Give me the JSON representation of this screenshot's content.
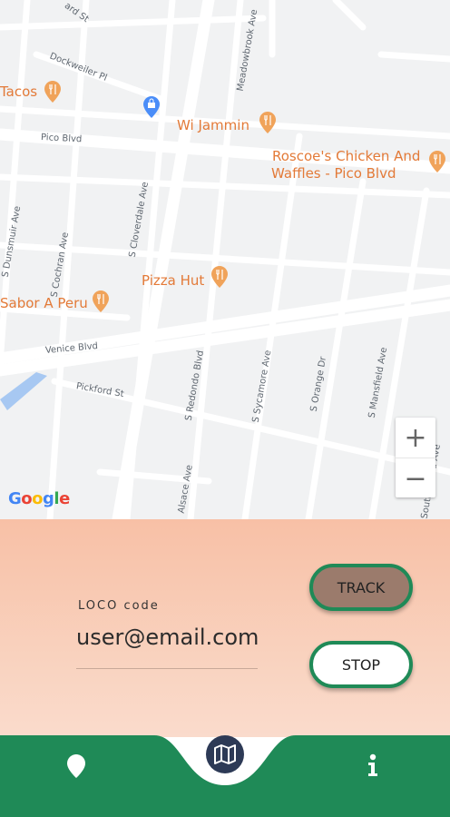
{
  "map": {
    "streets": {
      "gilmore": "ard St",
      "dockweiler": "Dockweiler Pl",
      "meadowbrook": "Meadowbrook Ave",
      "pico": "Pico Blvd",
      "dunsmuir": "S Dunsmuir Ave",
      "cochran": "S Cochran Ave",
      "cloverdale": "S Cloverdale Ave",
      "venice": "Venice Blvd",
      "pickford": "Pickford St",
      "redondo": "S Redondo Blvd",
      "sycamore": "S Sycamore Ave",
      "orange": "S Orange Dr",
      "mansfield": "S Mansfield Ave",
      "alsace": "Alsace Ave",
      "south_sierra": "South Sierra Ave"
    },
    "pois": {
      "tacos": "Tacos",
      "wi_jammin": "Wi Jammin",
      "roscoes_line1": "Roscoe's Chicken And",
      "roscoes_line2": "Waffles - Pico Blvd",
      "pizza_hut": "Pizza Hut",
      "sabor": "Sabor A Peru"
    },
    "zoom_in": "+",
    "zoom_out": "−",
    "attribution": [
      "G",
      "o",
      "o",
      "g",
      "l",
      "e"
    ],
    "colors": {
      "poi": "#e37a38",
      "shop_pin": "#4a8df8"
    }
  },
  "panel": {
    "code_label": "LOCO code",
    "code_value": "user@email.com",
    "track_label": "TRACK",
    "stop_label": "STOP"
  },
  "nav": {
    "items": [
      "location",
      "map",
      "info"
    ],
    "accent": "#1f8a57",
    "center_circle": "#2d3a56"
  }
}
